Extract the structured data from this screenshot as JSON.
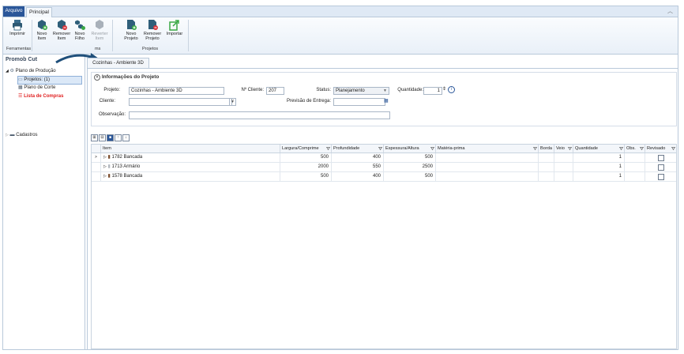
{
  "tabs": {
    "file": "Arquivo",
    "main": "Principal"
  },
  "ribbon": {
    "buttons": [
      {
        "label1": "Imprimir",
        "label2": ""
      },
      {
        "label1": "Novo",
        "label2": "Item"
      },
      {
        "label1": "Remover",
        "label2": "Item"
      },
      {
        "label1": "Novo",
        "label2": "Filho"
      },
      {
        "label1": "Reverter",
        "label2": "Item"
      },
      {
        "label1": "Novo",
        "label2": "Projeto"
      },
      {
        "label1": "Remover",
        "label2": "Projeto"
      },
      {
        "label1": "Importar",
        "label2": ""
      }
    ],
    "groups": {
      "ferramentas": "Ferramentas",
      "itens": "ms",
      "projetos": "Projetos"
    }
  },
  "left_pane": {
    "title": "Promob Cut",
    "tree": {
      "plano_producao": "Plano de Produção",
      "projetos": "Projetos: (1)",
      "plano_corte": "Plano de Corte",
      "lista_compras": "Lista de Compras",
      "cadastros": "Cadastros"
    }
  },
  "doc_tab": "Cozinhas - Ambiente 3D",
  "info": {
    "title": "Informações do Projeto",
    "projeto_label": "Projeto:",
    "projeto_value": "Cozinhas - Ambiente 3D",
    "ncliente_label": "Nº Cliente:",
    "ncliente_value": "207",
    "status_label": "Status:",
    "status_value": "Planejamento",
    "quantidade_label": "Quantidade:",
    "quantidade_value": "1",
    "cliente_label": "Cliente:",
    "cliente_value": "",
    "previsao_label": "Previsão de Entrega:",
    "previsao_value": "",
    "observacao_label": "Observação:",
    "observacao_value": ""
  },
  "grid": {
    "columns": [
      "Item",
      "Largura/Comprime",
      "Profundidade",
      "Espessura/Altura",
      "Matéria-prima",
      "Borda",
      "Veio",
      "Quantidade",
      "Obs.",
      "Revisado"
    ],
    "rows": [
      {
        "item": "1782 Bancada",
        "largura": "500",
        "profundidade": "400",
        "espessura": "500",
        "materia": "",
        "quantidade": "1"
      },
      {
        "item": "1713 Armário",
        "largura": "2000",
        "profundidade": "550",
        "espessura": "2500",
        "materia": "",
        "quantidade": "1"
      },
      {
        "item": "1578 Bancada",
        "largura": "500",
        "profundidade": "400",
        "espessura": "500",
        "materia": "",
        "quantidade": "1"
      }
    ]
  }
}
